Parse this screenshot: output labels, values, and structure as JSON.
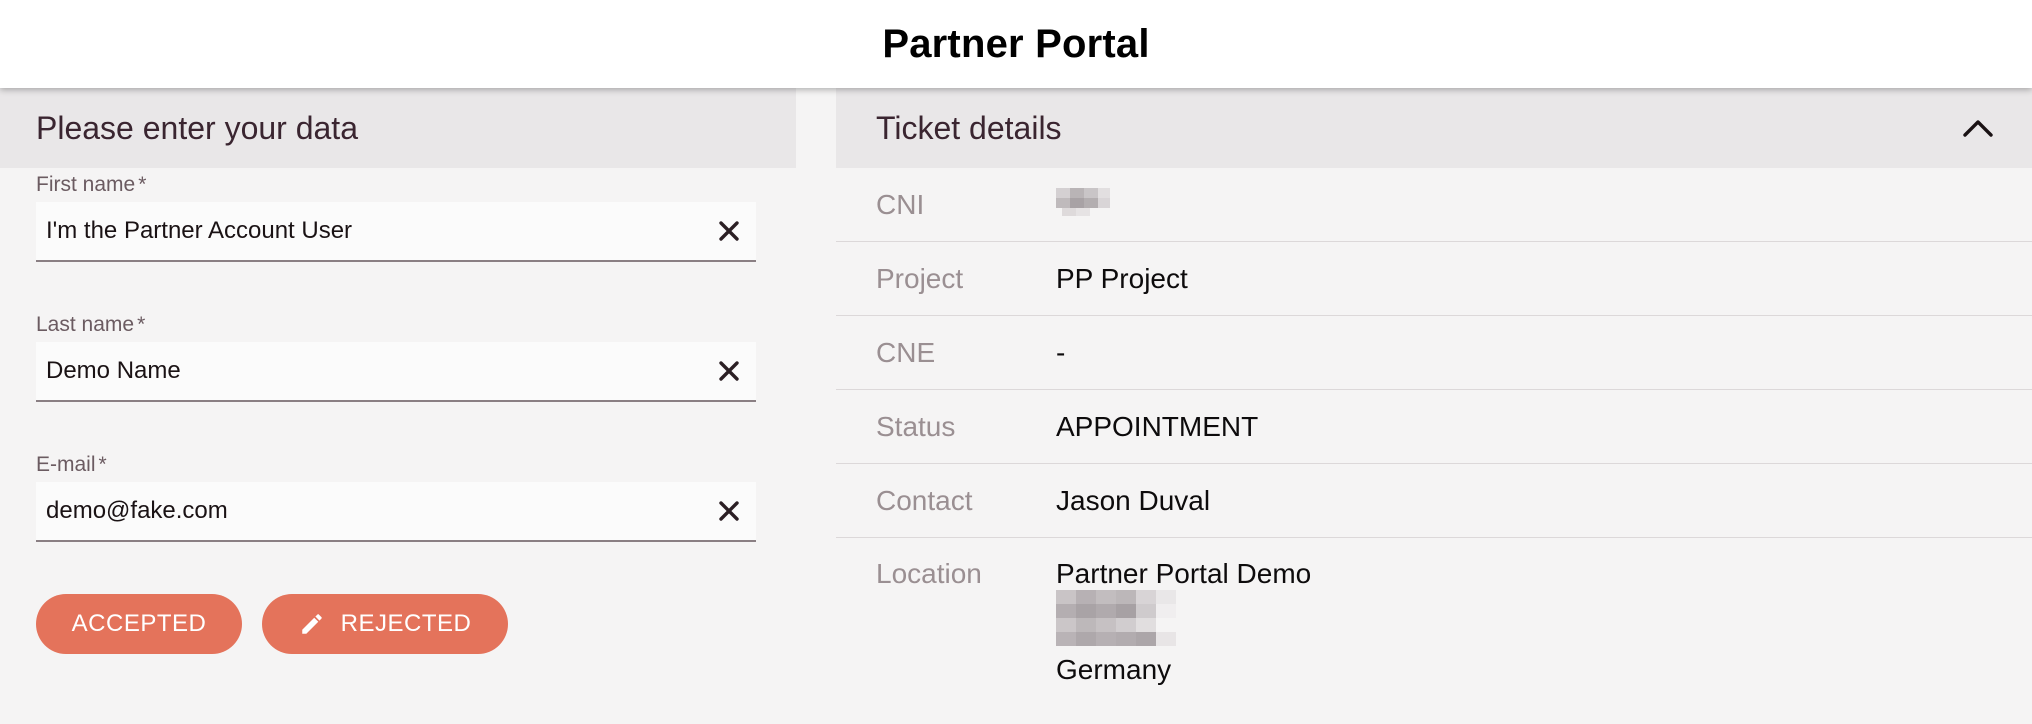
{
  "header": {
    "title": "Partner Portal"
  },
  "form": {
    "title": "Please enter your data",
    "fields": [
      {
        "label": "First name",
        "required_mark": "*",
        "value": "I'm the Partner Account User"
      },
      {
        "label": "Last name",
        "required_mark": "*",
        "value": "Demo Name"
      },
      {
        "label": "E-mail",
        "required_mark": "*",
        "value": "demo@fake.com"
      }
    ],
    "accepted_label": "ACCEPTED",
    "rejected_label": "REJECTED"
  },
  "ticket": {
    "title": "Ticket details",
    "rows": [
      {
        "key": "CNI",
        "value": ""
      },
      {
        "key": "Project",
        "value": "PP Project"
      },
      {
        "key": "CNE",
        "value": "-"
      },
      {
        "key": "Status",
        "value": "APPOINTMENT"
      },
      {
        "key": "Contact",
        "value": "Jason Duval"
      },
      {
        "key": "Location",
        "value_line1": "Partner Portal Demo",
        "value_line3": "Germany"
      }
    ]
  },
  "colors": {
    "accent": "#e4735b",
    "header_bg": "#e9e7e8",
    "page_bg": "#f5f4f4"
  },
  "icons": {
    "clear": "close-icon",
    "edit": "pencil-icon",
    "collapse": "chevron-up-icon"
  }
}
